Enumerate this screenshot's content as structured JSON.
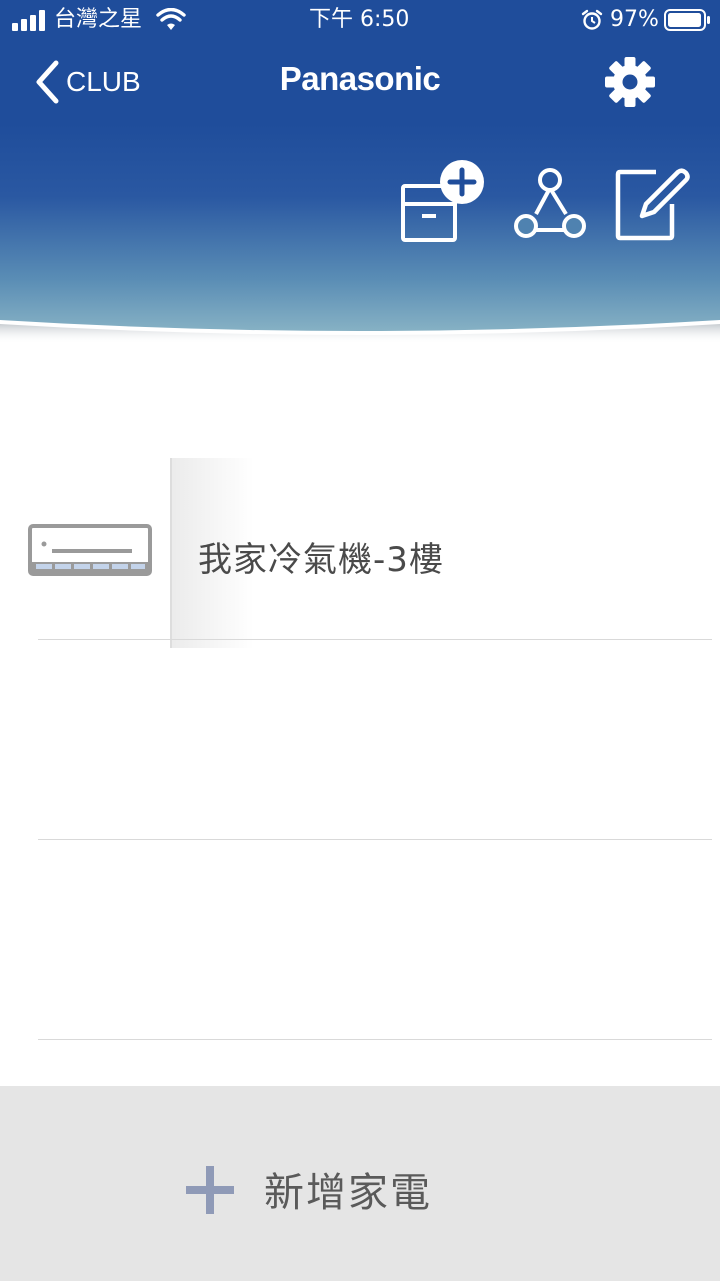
{
  "status": {
    "carrier": "台灣之星",
    "time": "下午 6:50",
    "battery": "97%",
    "battery_level": 0.97
  },
  "nav": {
    "back_label": "CLUB",
    "brand": "Panasonic",
    "settings_icon": "gear-icon"
  },
  "toolbar": {
    "icons": [
      "add-group-icon",
      "share-icon",
      "edit-icon"
    ]
  },
  "devices": [
    {
      "name": "我家冷氣機-3樓",
      "icon": "air-conditioner-icon"
    },
    {
      "name": ""
    },
    {
      "name": ""
    }
  ],
  "footer": {
    "add_label": "新增家電",
    "icon": "plus-icon"
  },
  "colors": {
    "header_blue": "#1f4d9b",
    "banner_bottom": "#7aa9bf",
    "footer_bg": "#e5e5e5",
    "plus_color": "#8f9ab7"
  }
}
